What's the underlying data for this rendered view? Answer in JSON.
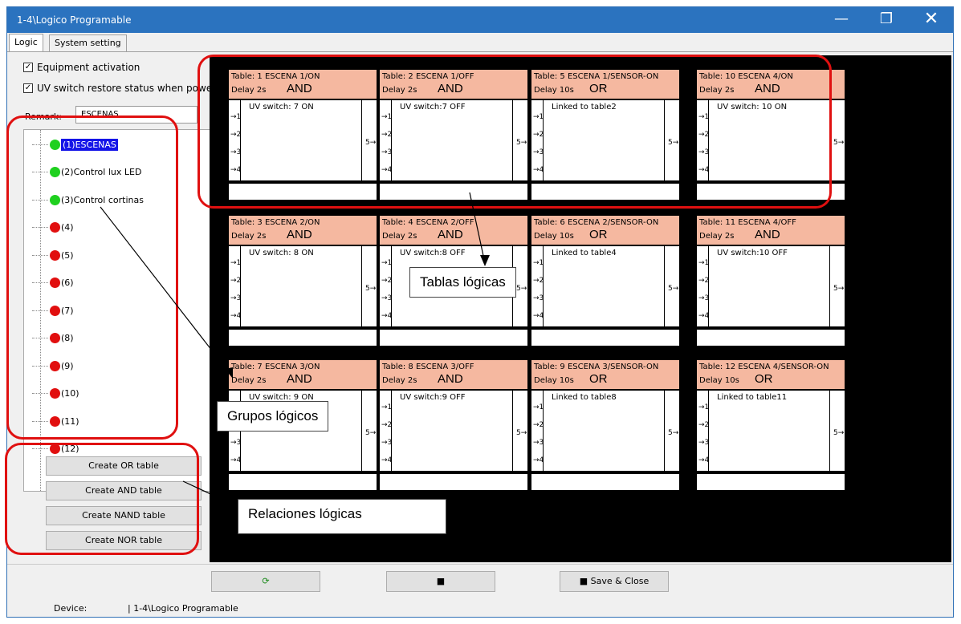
{
  "window": {
    "title": "1-4\\Logico Programable"
  },
  "tabs": [
    "Logic",
    "System setting"
  ],
  "options": {
    "equipment_activation": "Equipment activation",
    "uv_restore": "UV switch restore status when power on"
  },
  "remark": {
    "label": "Remark:",
    "value": "ESCENAS"
  },
  "tree": [
    {
      "label": "(1)ESCENAS",
      "status": "green",
      "selected": true
    },
    {
      "label": "(2)Control lux LED",
      "status": "green"
    },
    {
      "label": "(3)Control cortinas",
      "status": "green"
    },
    {
      "label": "(4)",
      "status": "red"
    },
    {
      "label": "(5)",
      "status": "red"
    },
    {
      "label": "(6)",
      "status": "red"
    },
    {
      "label": "(7)",
      "status": "red"
    },
    {
      "label": "(8)",
      "status": "red"
    },
    {
      "label": "(9)",
      "status": "red"
    },
    {
      "label": "(10)",
      "status": "red"
    },
    {
      "label": "(11)",
      "status": "red"
    },
    {
      "label": "(12)",
      "status": "red"
    }
  ],
  "buttons": {
    "or": "Create OR table",
    "and": "Create AND table",
    "nand": "Create NAND table",
    "nor": "Create NOR table"
  },
  "tables": [
    {
      "title": "Table: 1 ESCENA 1/ON",
      "delay": "Delay 2s",
      "op": "AND",
      "content": "UV switch: 7 ON"
    },
    {
      "title": "Table: 2 ESCENA 1/OFF",
      "delay": "Delay 2s",
      "op": "AND",
      "content": "UV switch:7 OFF"
    },
    {
      "title": "Table: 5 ESCENA 1/SENSOR-ON",
      "delay": "Delay 10s",
      "op": "OR",
      "content": "Linked to table2"
    },
    {
      "title": "Table: 10 ESCENA 4/ON",
      "delay": "Delay 2s",
      "op": "AND",
      "content": "UV switch: 10 ON"
    },
    {
      "title": "Table: 3 ESCENA 2/ON",
      "delay": "Delay 2s",
      "op": "AND",
      "content": "UV switch: 8 ON"
    },
    {
      "title": "Table: 4 ESCENA 2/OFF",
      "delay": "Delay 2s",
      "op": "AND",
      "content": "UV switch:8 OFF"
    },
    {
      "title": "Table: 6 ESCENA 2/SENSOR-ON",
      "delay": "Delay 10s",
      "op": "OR",
      "content": "Linked to table4"
    },
    {
      "title": "Table: 11 ESCENA 4/OFF",
      "delay": "Delay 2s",
      "op": "AND",
      "content": "UV switch:10 OFF"
    },
    {
      "title": "Table: 7 ESCENA 3/ON",
      "delay": "Delay 2s",
      "op": "AND",
      "content": "UV switch: 9 ON"
    },
    {
      "title": "Table: 8 ESCENA 3/OFF",
      "delay": "Delay 2s",
      "op": "AND",
      "content": "UV switch:9 OFF"
    },
    {
      "title": "Table: 9 ESCENA 3/SENSOR-ON",
      "delay": "Delay 10s",
      "op": "OR",
      "content": "Linked to table8"
    },
    {
      "title": "Table: 12 ESCENA 4/SENSOR-ON",
      "delay": "Delay 10s",
      "op": "OR",
      "content": "Linked to table11"
    }
  ],
  "pins": {
    "in1": "1",
    "in2": "2",
    "in3": "3",
    "in4": "4",
    "out": "5"
  },
  "callouts": {
    "tables": "Tablas lógicas",
    "groups": "Grupos lógicos",
    "relations": "Relaciones lógicas"
  },
  "bottom": {
    "save_close": "Save & Close",
    "device_label": "Device:",
    "device_value": "| 1-4\\Logico Programable"
  },
  "colors": {
    "titlebar": "#2b73bf",
    "table_header": "#f5b8a0",
    "annotation": "#e01010",
    "canvas": "#000000"
  },
  "icons": [
    "refresh-icon",
    "save-icon",
    "minimize-icon",
    "maximize-icon",
    "close-icon"
  ]
}
